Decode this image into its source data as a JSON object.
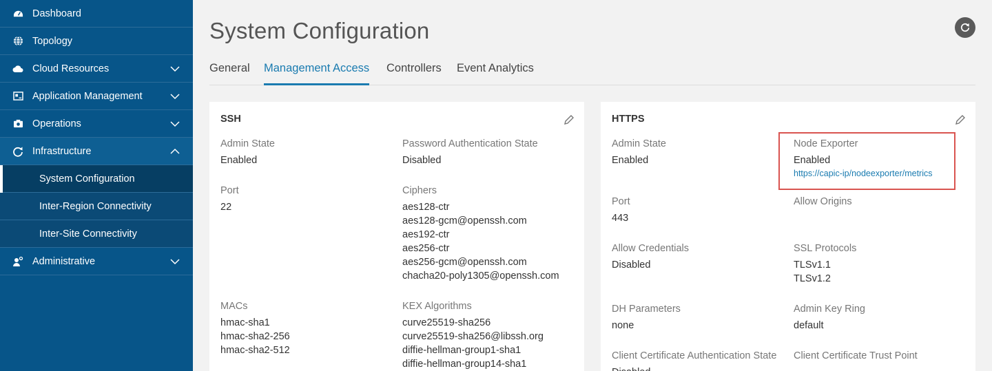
{
  "sidebar": {
    "items": [
      {
        "label": "Dashboard"
      },
      {
        "label": "Topology"
      },
      {
        "label": "Cloud Resources"
      },
      {
        "label": "Application Management"
      },
      {
        "label": "Operations"
      },
      {
        "label": "Infrastructure"
      },
      {
        "label": "Administrative"
      }
    ],
    "subitems": [
      {
        "label": "System Configuration"
      },
      {
        "label": "Inter-Region Connectivity"
      },
      {
        "label": "Inter-Site Connectivity"
      }
    ]
  },
  "page": {
    "title": "System Configuration"
  },
  "tabs": [
    {
      "label": "General"
    },
    {
      "label": "Management Access"
    },
    {
      "label": "Controllers"
    },
    {
      "label": "Event Analytics"
    }
  ],
  "ssh": {
    "title": "SSH",
    "admin_state": {
      "label": "Admin State",
      "value": "Enabled"
    },
    "password_auth": {
      "label": "Password Authentication State",
      "value": "Disabled"
    },
    "port": {
      "label": "Port",
      "value": "22"
    },
    "ciphers": {
      "label": "Ciphers",
      "values": [
        "aes128-ctr",
        "aes128-gcm@openssh.com",
        "aes192-ctr",
        "aes256-ctr",
        "aes256-gcm@openssh.com",
        "chacha20-poly1305@openssh.com"
      ]
    },
    "macs": {
      "label": "MACs",
      "values": [
        "hmac-sha1",
        "hmac-sha2-256",
        "hmac-sha2-512"
      ]
    },
    "kex": {
      "label": "KEX Algorithms",
      "values": [
        "curve25519-sha256",
        "curve25519-sha256@libssh.org",
        "diffie-hellman-group1-sha1",
        "diffie-hellman-group14-sha1"
      ]
    }
  },
  "https": {
    "title": "HTTPS",
    "admin_state": {
      "label": "Admin State",
      "value": "Enabled"
    },
    "node_exporter": {
      "label": "Node Exporter",
      "value": "Enabled",
      "link": "https://capic-ip/nodeexporter/metrics"
    },
    "port": {
      "label": "Port",
      "value": "443"
    },
    "allow_origins": {
      "label": "Allow Origins",
      "value": ""
    },
    "allow_credentials": {
      "label": "Allow Credentials",
      "value": "Disabled"
    },
    "ssl_protocols": {
      "label": "SSL Protocols",
      "values": [
        "TLSv1.1",
        "TLSv1.2"
      ]
    },
    "dh_parameters": {
      "label": "DH Parameters",
      "value": "none"
    },
    "admin_key_ring": {
      "label": "Admin Key Ring",
      "value": "default"
    },
    "client_cert_auth": {
      "label": "Client Certificate Authentication State",
      "value": "Disabled"
    },
    "client_cert_trust": {
      "label": "Client Certificate Trust Point"
    }
  },
  "icons": {
    "dashboard": "dashboard-icon",
    "topology": "globe-icon",
    "cloud": "cloud-icon",
    "application": "window-icon",
    "operations": "camera-icon",
    "infrastructure": "refresh-circle-icon",
    "administrative": "user-gear-icon",
    "refresh": "refresh-icon",
    "edit": "pencil-icon"
  },
  "colors": {
    "sidebar": "#075589",
    "accent": "#1a7bb0",
    "highlight": "#d9534f"
  }
}
